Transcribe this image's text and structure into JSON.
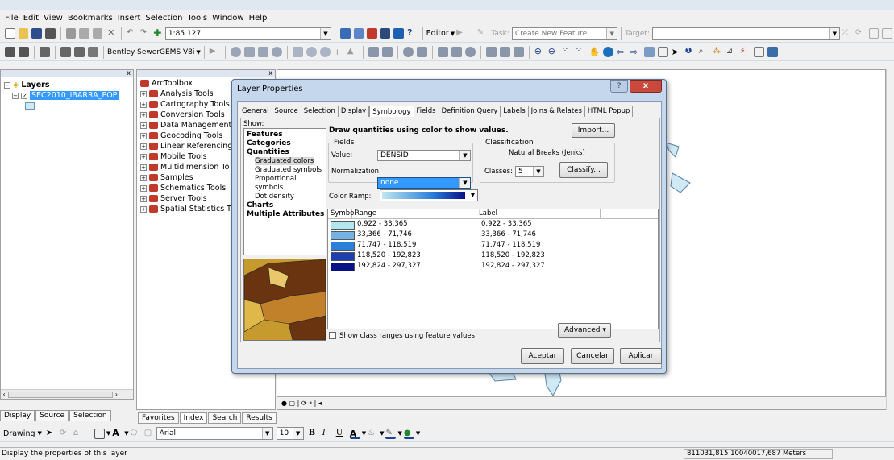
{
  "menu": [
    "File",
    "Edit",
    "View",
    "Bookmarks",
    "Insert",
    "Selection",
    "Tools",
    "Window",
    "Help"
  ],
  "toolbar": {
    "scale_value": "1:85.127",
    "editor_label": "Editor",
    "task_label": "Task:",
    "task_value": "Create New Feature",
    "target_label": "Target:",
    "sewergems_label": "Bentley SewerGEMS V8i"
  },
  "toc": {
    "root_label": "Layers",
    "layer_name": "SEC2010_IBARRA_POP",
    "tabs": [
      "Display",
      "Source",
      "Selection"
    ]
  },
  "toolbox": {
    "root_label": "ArcToolbox",
    "items": [
      "Analysis Tools",
      "Cartography Tools",
      "Conversion Tools",
      "Data Management",
      "Geocoding Tools",
      "Linear Referencing",
      "Mobile Tools",
      "Multidimension To",
      "Samples",
      "Schematics Tools",
      "Server Tools",
      "Spatial Statistics To"
    ],
    "tabs": [
      "Favorites",
      "Index",
      "Search",
      "Results"
    ]
  },
  "dialog": {
    "title": "Layer Properties",
    "help_glyph": "?",
    "close_glyph": "x",
    "tabs": [
      "General",
      "Source",
      "Selection",
      "Display",
      "Symbology",
      "Fields",
      "Definition Query",
      "Labels",
      "Joins & Relates",
      "HTML Popup"
    ],
    "show_label": "Show:",
    "show_items": [
      "Features",
      "Categories",
      "Quantities",
      "Graduated colors",
      "Graduated symbols",
      "Proportional symbols",
      "Dot density",
      "Charts",
      "Multiple Attributes"
    ],
    "header_text": "Draw quantities using color to show values.",
    "import_button": "Import...",
    "fields_label": "Fields",
    "value_label": "Value:",
    "value_field": "DENSID",
    "normalization_label": "Normalization:",
    "normalization_value": "none",
    "classification_label": "Classification",
    "classification_method": "Natural Breaks (Jenks)",
    "classes_label": "Classes:",
    "classes_value": "5",
    "classify_button": "Classify...",
    "color_ramp_label": "Color Ramp:",
    "columns": [
      "Symbol",
      "Range",
      "Label"
    ],
    "classes": [
      {
        "range": "0,922 - 33,365",
        "label": "0,922 - 33,365",
        "color": "#b3e6ef"
      },
      {
        "range": "33,366 - 71,746",
        "label": "33,366 - 71,746",
        "color": "#74b1e4"
      },
      {
        "range": "71,747 - 118,519",
        "label": "71,747 - 118,519",
        "color": "#2b7fd9"
      },
      {
        "range": "118,520 - 192,823",
        "label": "118,520 - 192,823",
        "color": "#1d3fb1"
      },
      {
        "range": "192,824 - 297,327",
        "label": "192,824 - 297,327",
        "color": "#0a1187"
      }
    ],
    "show_ranges_checkbox": "Show class ranges using feature values",
    "advanced_button": "Advanced",
    "ok_button": "Aceptar",
    "cancel_button": "Cancelar",
    "apply_button": "Aplicar"
  },
  "drawing_toolbar": {
    "drawing_label": "Drawing",
    "font_name": "Arial",
    "font_size": "10"
  },
  "status": {
    "message": "Display the properties of this layer",
    "coordinates": "811031,815  10040017,687 Meters"
  }
}
